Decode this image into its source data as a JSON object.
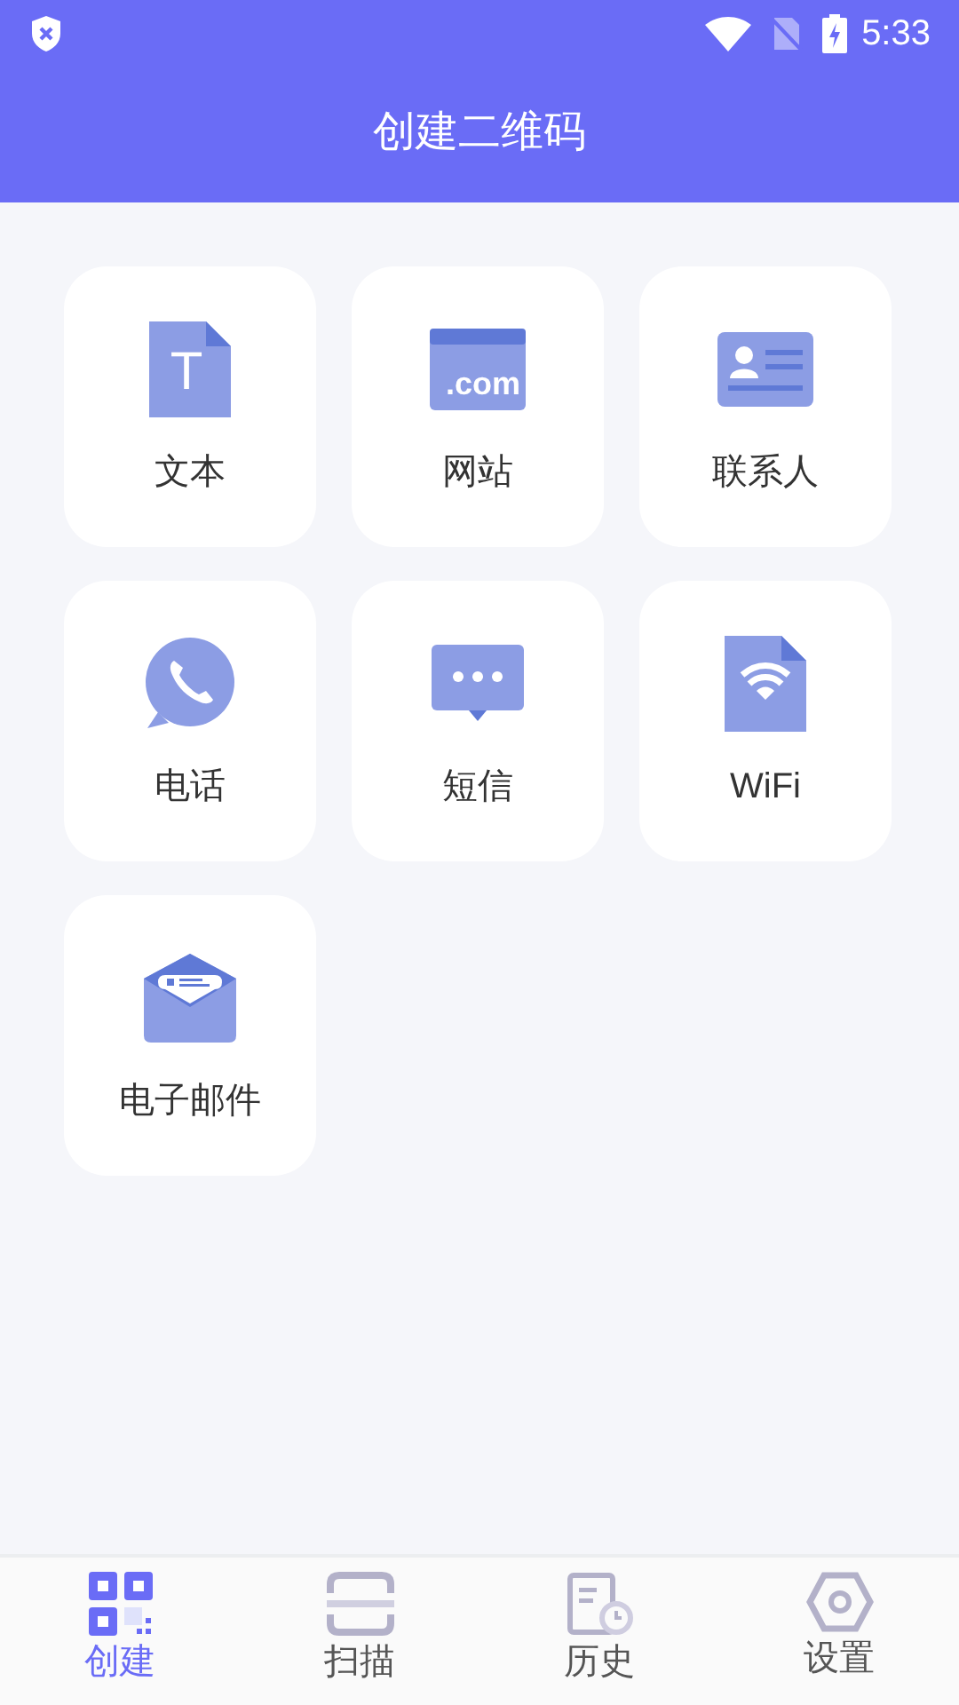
{
  "status_bar": {
    "time": "5:33"
  },
  "header": {
    "title": "创建二维码"
  },
  "items": [
    {
      "kind": "text",
      "label": "文本",
      "icon_text": "T"
    },
    {
      "kind": "website",
      "label": "网站",
      "icon_text": ".com"
    },
    {
      "kind": "contact",
      "label": "联系人"
    },
    {
      "kind": "phone",
      "label": "电话"
    },
    {
      "kind": "sms",
      "label": "短信"
    },
    {
      "kind": "wifi",
      "label": "WiFi"
    },
    {
      "kind": "email",
      "label": "电子邮件"
    }
  ],
  "bottom_nav": [
    {
      "kind": "create",
      "label": "创建",
      "selected": true
    },
    {
      "kind": "scan",
      "label": "扫描",
      "selected": false
    },
    {
      "kind": "history",
      "label": "历史",
      "selected": false
    },
    {
      "kind": "settings",
      "label": "设置",
      "selected": false
    }
  ]
}
